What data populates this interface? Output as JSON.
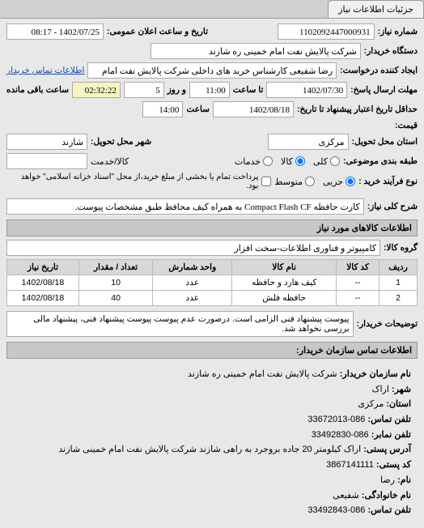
{
  "tabs": {
    "tab1": "جزئیات اطلاعات نیاز"
  },
  "form": {
    "req_number_label": "شماره نیاز:",
    "req_number": "1102092447000931",
    "announce_date_label": "تاریخ و ساعت اعلان عمومی:",
    "announce_date": "1402/07/25 - 08:17",
    "buyer_org_label": "دستگاه خریدار:",
    "buyer_org": "شرکت پالایش نفت امام خمینی ره شازند",
    "requester_label": "ایجاد کننده درخواست:",
    "requester": "رضا شفیعی کارشناس خرید های داخلی شرکت پالایش نفت امام خمینی ره",
    "buyer_contact_link": "اطلاعات تماس خریدار",
    "reply_deadline_label": "مهلت ارسال پاسخ:",
    "reply_date": "1402/07/30",
    "reply_saat_label": "تا ساعت",
    "reply_time": "11:00",
    "reply_rooz_label": "و روز",
    "reply_days": "5",
    "remaining_label": "ساعت باقی مانده",
    "remaining": "02:32:22",
    "delivery_date_label": "حداقل تاریخ اعتبار پیشنهاد تا تاریخ:",
    "delivery_date": "1402/08/18",
    "delivery_saat_label": "ساعت",
    "delivery_time": "14:00",
    "price_label": "قیمت:",
    "province_label": "استان محل تحویل:",
    "province": "مرکزی",
    "city_label": "شهر محل تحویل:",
    "city": "شازند",
    "budget_label": "طبقه بندی موضوعی:",
    "radio_all": "کلی",
    "radio_kala": "کالا",
    "radio_khadamat": "خدمات",
    "kala_khedmat": "کالا/خدمت",
    "process_label": "نوع فرآیند خرید :",
    "radio_jozei": "جزیی",
    "radio_motavasset": "متوسط",
    "process_text": "پرداخت تمام یا بخشی از مبلغ خرید،از محل \"اسناد خزانه اسلامی\" خواهد بود."
  },
  "need_title": {
    "label": "شرح کلی نیاز:",
    "value": "کارت حافظه Compact Flash CF به همراه کیف محافظ طبق مشخصات پیوست."
  },
  "goods_section": {
    "header": "اطلاعات کالاهای مورد نیاز",
    "group_label": "گروه کالا:",
    "group_value": "کامپیوتر و فناوری اطلاعات-سخت افزار"
  },
  "table": {
    "headers": {
      "row": "ردیف",
      "code": "کد کالا",
      "name": "نام کالا",
      "unit": "واحد شمارش",
      "qty": "تعداد / مقدار",
      "date": "تاریخ نیاز"
    },
    "rows": [
      {
        "row": "1",
        "code": "--",
        "name": "کیف هارد و حافظه",
        "unit": "عدد",
        "qty": "10",
        "date": "1402/08/18"
      },
      {
        "row": "2",
        "code": "--",
        "name": "حافظه فلش",
        "unit": "عدد",
        "qty": "40",
        "date": "1402/08/18"
      }
    ]
  },
  "buyer_notes": {
    "label": "توضیحات خریدار:",
    "value": "پیوست پیشنهاد فنی الزامی است. درصورت عدم پیوست پیوست پیشنهاد فنی، پیشنهاد مالی بررسی نخواهد شد."
  },
  "contact": {
    "header": "اطلاعات تماس سازمان خریدار:",
    "org_label": "نام سازمان خریدار:",
    "org": "شرکت پالایش نفت امام خمینی ره شازند",
    "city_label": "شهر:",
    "city": "اراک",
    "province_label": "استان:",
    "province": "مرکزی",
    "phone_label": "تلفن تماس:",
    "phone": "086-33672013",
    "fax_label": "تلفن نمابر:",
    "fax": "086-33492830",
    "postal_address_label": "آدرس پستی:",
    "postal_address": "اراک کیلومتر 20 جاده بروجرد به راهی شازند شرکت پالایش نفت امام خمینی شازند",
    "postal_code_label": "کد پستی:",
    "postal_code": "3867141111",
    "name_label": "نام:",
    "name": "رضا",
    "family_label": "نام خانوادگی:",
    "family": "شفیعی",
    "contact_phone_label": "تلفن تماس:",
    "contact_phone": "086-33492843"
  }
}
